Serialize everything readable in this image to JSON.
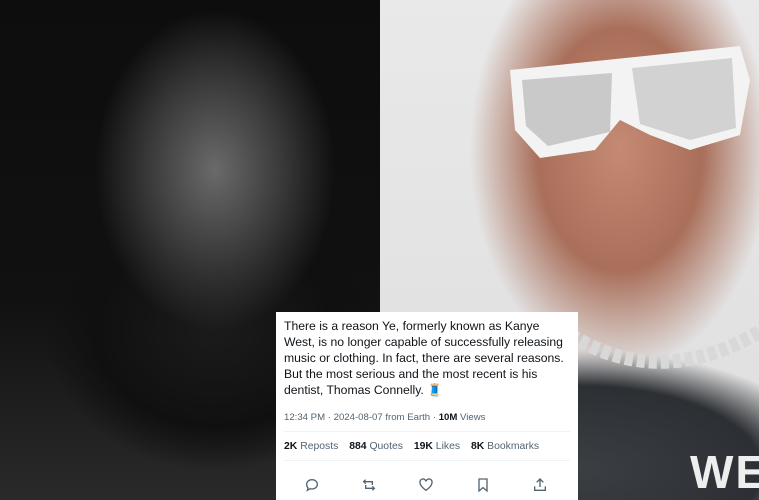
{
  "tweet": {
    "text": "There is a reason Ye, formerly known as Kanye West, is no longer capable of successfully releasing music or clothing. In fact, there are several reasons. But the most serious and the most recent is his dentist, Thomas Connelly. 🧵",
    "time": "12:34 PM",
    "date": "2024-08-07",
    "source": "from Earth",
    "views_count": "10M",
    "views_label": "Views",
    "reposts_count": "2K",
    "reposts_label": "Reposts",
    "quotes_count": "884",
    "quotes_label": "Quotes",
    "likes_count": "19K",
    "likes_label": "Likes",
    "bookmarks_count": "8K",
    "bookmarks_label": "Bookmarks"
  },
  "photo": {
    "shirt_text": "WE"
  },
  "colors": {
    "text_primary": "#0f1419",
    "text_secondary": "#536471",
    "icon": "#536471"
  },
  "icons": [
    "reply-icon",
    "repost-icon",
    "like-icon",
    "bookmark-icon",
    "share-icon"
  ]
}
